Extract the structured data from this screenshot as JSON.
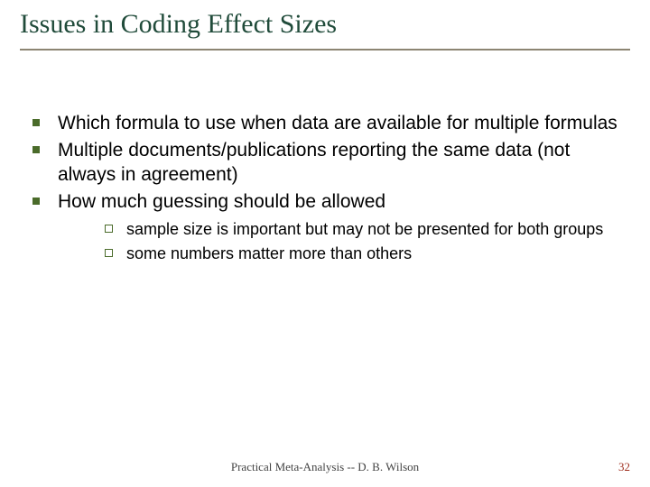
{
  "title": "Issues in Coding Effect Sizes",
  "bullets": [
    {
      "text": "Which formula to use when data are available for multiple formulas"
    },
    {
      "text": "Multiple documents/publications reporting the same data (not always in agreement)"
    },
    {
      "text": "How much guessing should be allowed",
      "sub": [
        "sample size is important but may not be presented for both groups",
        "some numbers matter more than others"
      ]
    }
  ],
  "footer": "Practical Meta-Analysis -- D. B. Wilson",
  "page_number": "32"
}
